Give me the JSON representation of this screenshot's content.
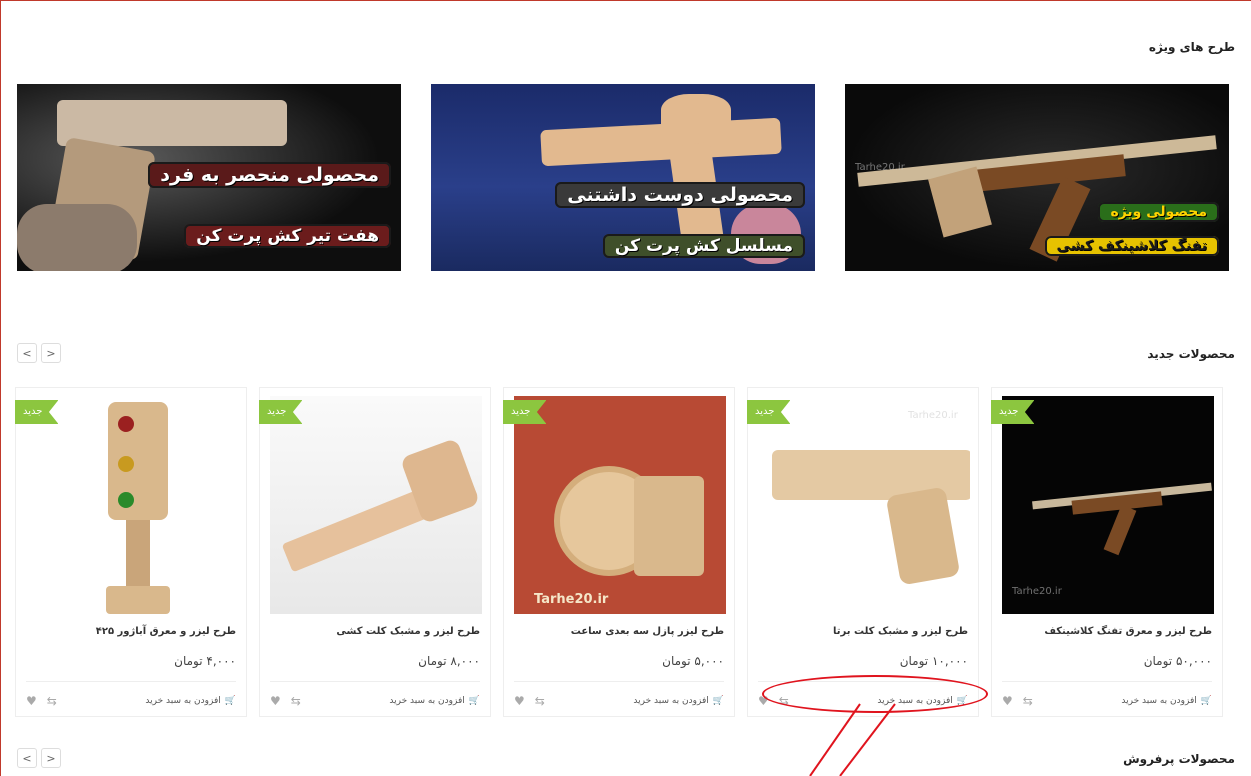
{
  "sections": {
    "special_title": "طرح های ویژه",
    "new_title": "محصولات جدید",
    "best_title": "محصولات پرفروش"
  },
  "banners": [
    {
      "line1": "محصولی ویژه",
      "line2": "تفنگ کلاشینکف کشی"
    },
    {
      "line1": "محصولی دوست داشتنی",
      "line2": "مسلسل کش پرت کن"
    },
    {
      "line1": "محصولی منحصر به فرد",
      "line2": "هفت تیر کش پرت کن"
    }
  ],
  "nav": {
    "prev": "<",
    "next": ">"
  },
  "products": [
    {
      "badge": "جدید",
      "name": "طرح لیزر و معرق تفنگ کلاشینکف",
      "price": "۵۰,۰۰۰ تومان",
      "cart": "افزودن به سبد خرید"
    },
    {
      "badge": "جدید",
      "name": "طرح لیزر و مشبک کلت برتا",
      "price": "۱۰,۰۰۰ تومان",
      "cart": "افزودن به سبد خرید"
    },
    {
      "badge": "جدید",
      "name": "طرح لیزر پازل سه بعدی ساعت",
      "price": "۵,۰۰۰ تومان",
      "cart": "افزودن به سبد خرید"
    },
    {
      "badge": "جدید",
      "name": "طرح لیزر و مشبک کلت کشی",
      "price": "۸,۰۰۰ تومان",
      "cart": "افزودن به سبد خرید"
    },
    {
      "badge": "جدید",
      "name": "طرح لیزر و معرق آباژور ۴۲۵",
      "price": "۴,۰۰۰ تومان",
      "cart": "افزودن به سبد خرید"
    }
  ],
  "watermark": "Tarhe20.ir",
  "icons": {
    "cart": "cart-icon",
    "compare": "compare-icon",
    "wishlist": "heart-icon"
  },
  "colors": {
    "badge": "#8cc63f",
    "callout": "#e0141e",
    "frame": "#c0392b"
  }
}
